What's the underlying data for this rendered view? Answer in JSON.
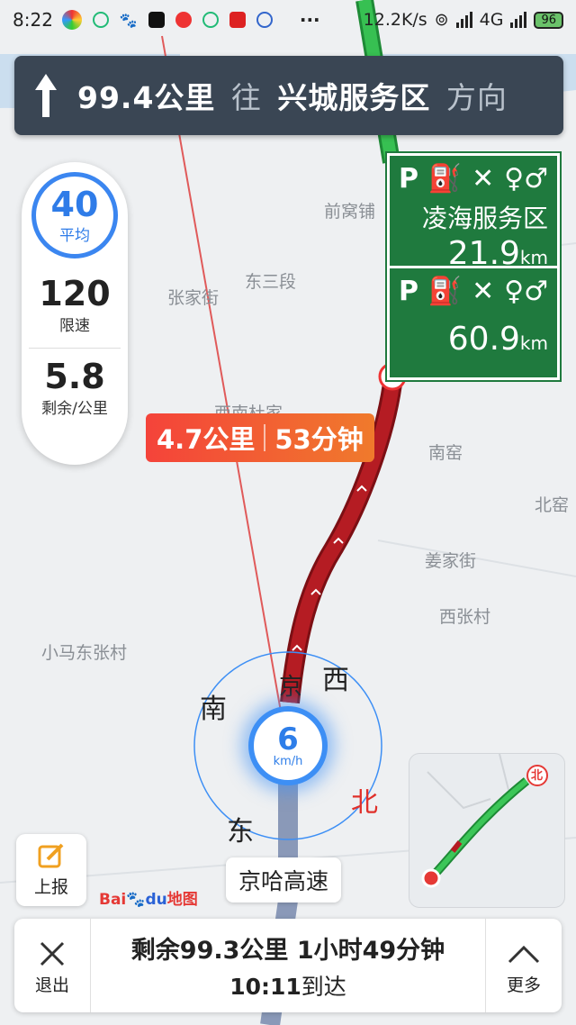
{
  "status_bar": {
    "time": "8:22",
    "net_speed": "12.2K/s",
    "network": "4G",
    "battery": "96",
    "app_icons": [
      "circle-app-icon",
      "app-icon-2",
      "paw-icon",
      "tiktok-icon",
      "weibo-icon",
      "app-icon-6",
      "news-icon",
      "app-icon-8"
    ],
    "more": "···"
  },
  "banner": {
    "distance": "99.4公里",
    "toward": "往",
    "target": "兴城服务区",
    "direction_word": "方向"
  },
  "speed_panel": {
    "avg_value": "40",
    "avg_label": "平均",
    "limit_value": "120",
    "limit_label": "限速",
    "remain_value": "5.8",
    "remain_label": "剩余/公里"
  },
  "service_areas": [
    {
      "name": "凌海服务区",
      "distance": "21.9",
      "unit": "km"
    },
    {
      "distance": "60.9",
      "unit": "km"
    }
  ],
  "eta_tag": {
    "distance": "4.7公里",
    "time": "53分钟"
  },
  "places": {
    "p1": "前窝铺",
    "p2": "东三段",
    "p3": "张家街",
    "p4": "西南杜家",
    "p5": "南窑",
    "p6": "北窑",
    "p7": "姜家街",
    "p8": "西张村",
    "p9": "小马东张村"
  },
  "compass": {
    "south": "南",
    "west": "西",
    "north": "北",
    "east": "东",
    "road_char": "京"
  },
  "current_speed": {
    "value": "6",
    "unit": "km/h"
  },
  "road_name": "京哈高速",
  "report_label": "上报",
  "baidu_logo": {
    "bai": "Bai",
    "du": "du",
    "map": "地图"
  },
  "bottom_bar": {
    "exit_label": "退出",
    "remaining": "剩余99.3公里 1小时49分钟",
    "arrival_time": "10:11",
    "arrival_label": "到达",
    "more_label": "更多"
  },
  "minimap_north": "北",
  "colors": {
    "route_congested": "#b51c23",
    "route_clear": "#33b84a",
    "service_green": "#1f7a3e",
    "accent_blue": "#3b86f0"
  }
}
